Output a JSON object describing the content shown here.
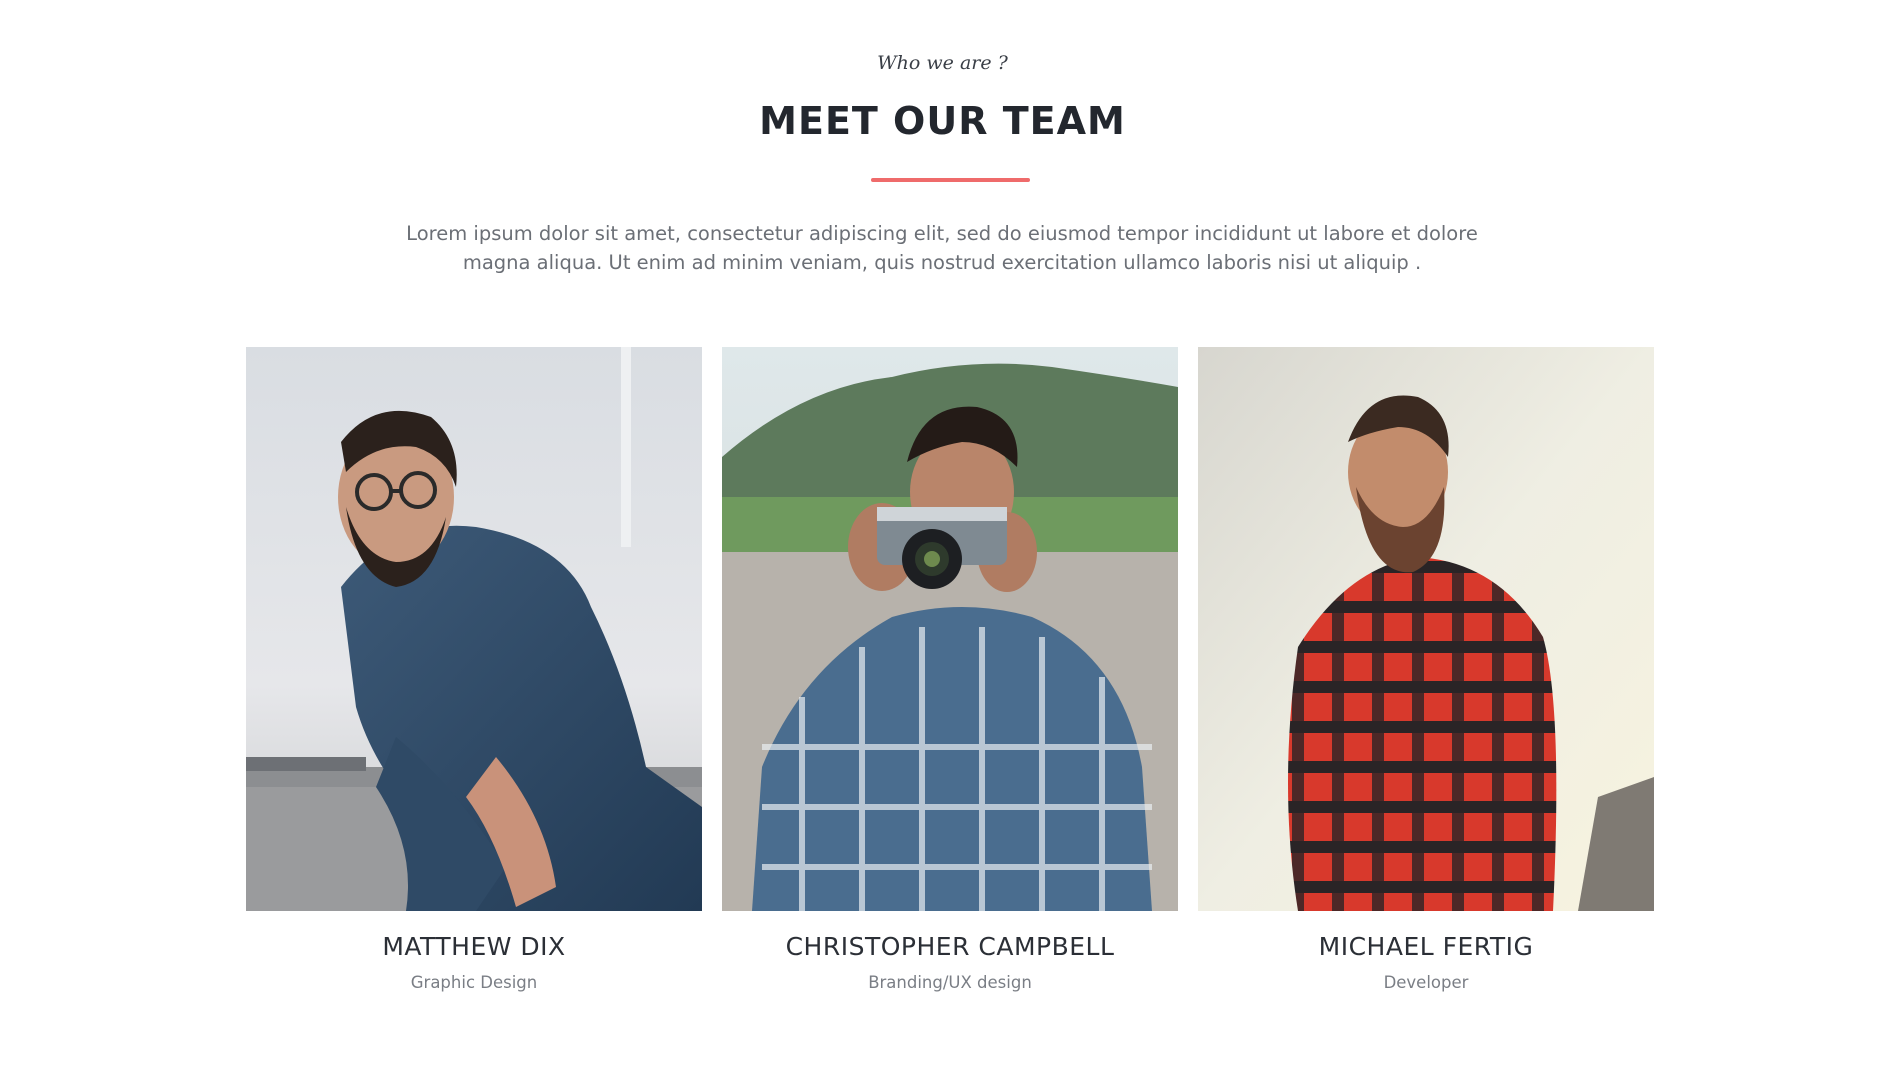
{
  "section": {
    "eyebrow": "Who we are ?",
    "title": "MEET OUR TEAM",
    "intro": "Lorem ipsum dolor sit amet, consectetur adipiscing elit, sed do eiusmod tempor incididunt ut labore et dolore magna aliqua. Ut enim ad minim veniam, quis nostrud exercitation ullamco laboris nisi ut aliquip .",
    "accent_color": "#ef6b6b"
  },
  "team": [
    {
      "name": "MATTHEW DIX",
      "role": "Graphic Design",
      "photo": "man-in-denim-shirt-photo"
    },
    {
      "name": "CHRISTOPHER CAMPBELL",
      "role": "Branding/UX design",
      "photo": "man-with-camera-photo"
    },
    {
      "name": "MICHAEL FERTIG",
      "role": "Developer",
      "photo": "man-in-plaid-shirt-photo"
    }
  ]
}
